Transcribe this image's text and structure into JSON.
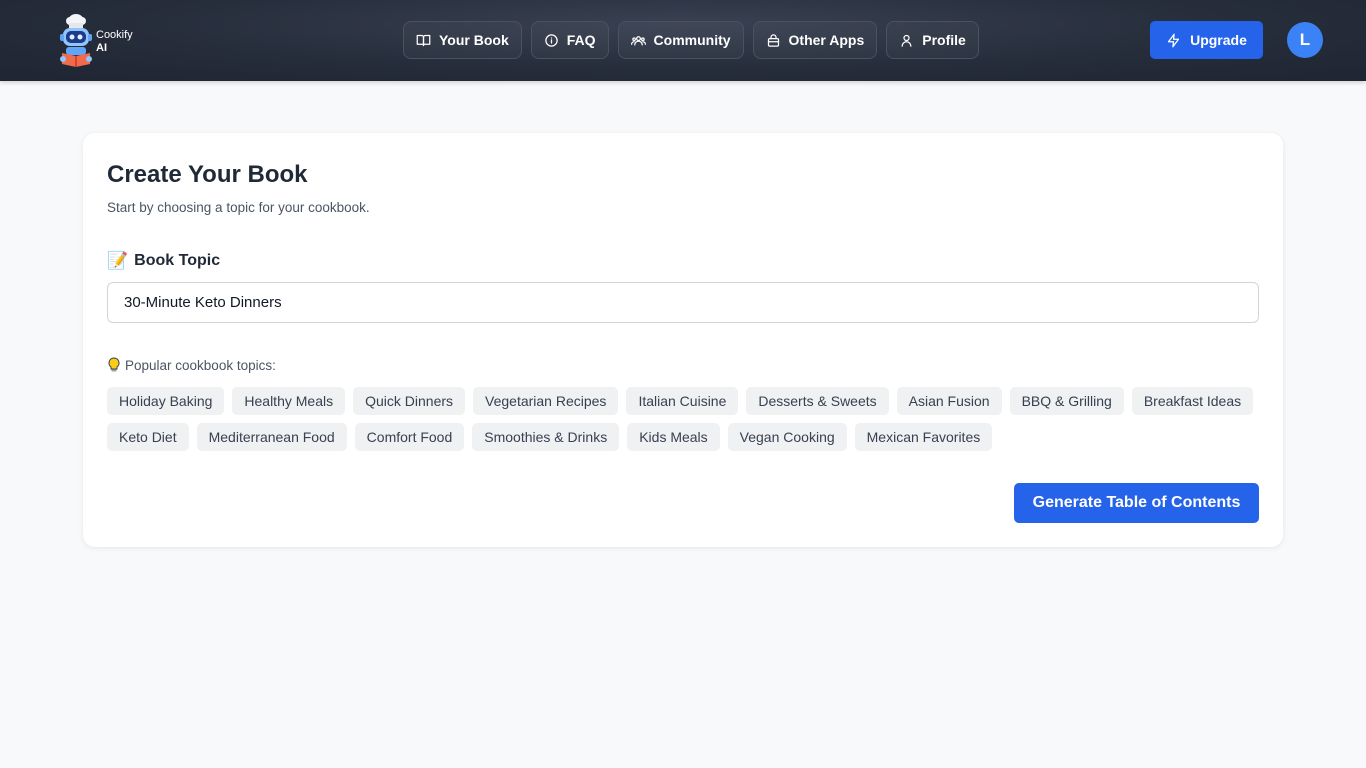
{
  "app": {
    "logo_name": "Cookify",
    "logo_suffix": "AI"
  },
  "nav": {
    "items": [
      {
        "label": "Your Book",
        "icon": "book-icon"
      },
      {
        "label": "FAQ",
        "icon": "info-icon"
      },
      {
        "label": "Community",
        "icon": "users-icon"
      },
      {
        "label": "Other Apps",
        "icon": "bag-icon"
      },
      {
        "label": "Profile",
        "icon": "user-icon"
      }
    ]
  },
  "header": {
    "upgrade_label": "Upgrade",
    "avatar_initial": "L"
  },
  "card": {
    "title": "Create Your Book",
    "subtitle": "Start by choosing a topic for your cookbook.",
    "field_label": "Book Topic",
    "field_emoji": "📝",
    "topic_value": "30-Minute Keto Dinners",
    "popular_label": "Popular cookbook topics:",
    "chips": [
      "Holiday Baking",
      "Healthy Meals",
      "Quick Dinners",
      "Vegetarian Recipes",
      "Italian Cuisine",
      "Desserts & Sweets",
      "Asian Fusion",
      "BBQ & Grilling",
      "Breakfast Ideas",
      "Keto Diet",
      "Mediterranean Food",
      "Comfort Food",
      "Smoothies & Drinks",
      "Kids Meals",
      "Vegan Cooking",
      "Mexican Favorites"
    ],
    "generate_label": "Generate Table of Contents"
  },
  "colors": {
    "accent": "#2563eb",
    "header_bg": "#262d3b",
    "avatar_bg": "#3b82f6",
    "chip_bg": "#f0f1f3"
  }
}
